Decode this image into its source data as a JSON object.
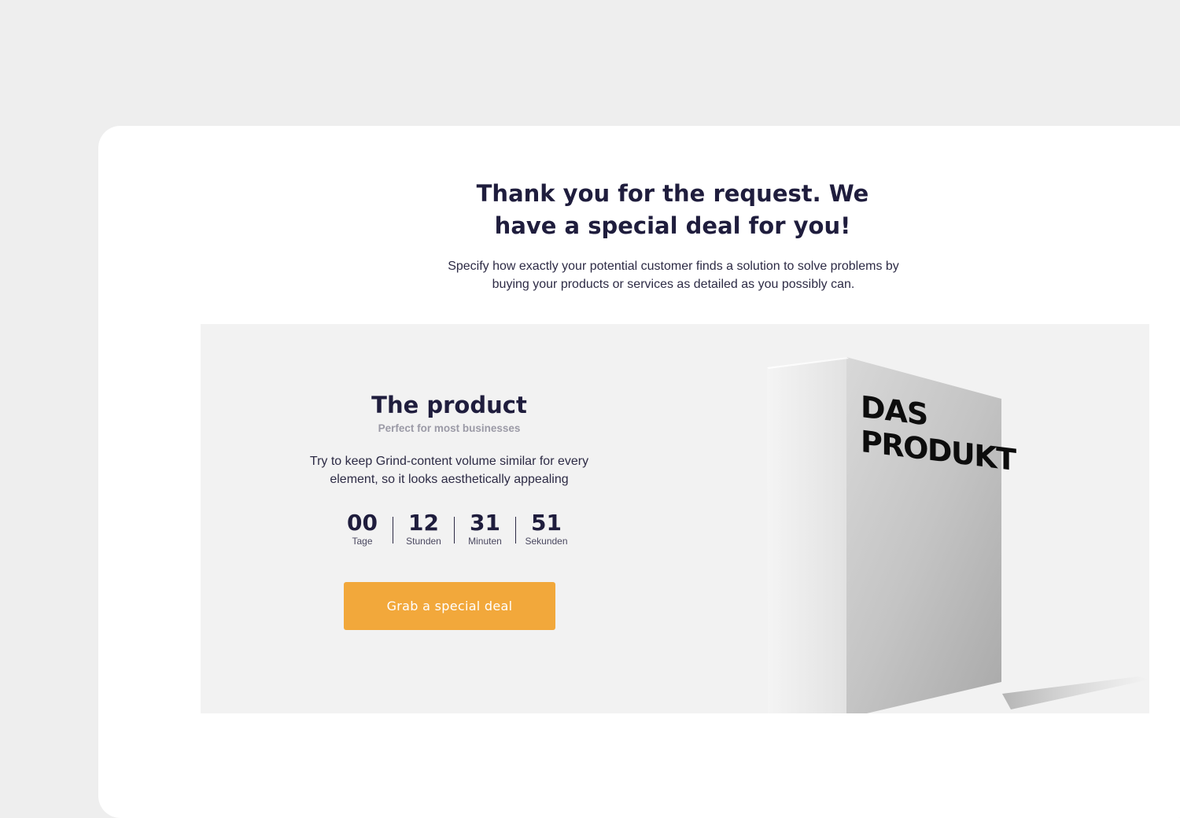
{
  "hero": {
    "title": "Thank you for the request. We have a special deal for you!",
    "description": "Specify how exactly your potential customer finds a solution to solve problems by buying your products or services as detailed as you possibly can."
  },
  "offer": {
    "product_title": "The product",
    "product_subtitle": "Perfect for most businesses",
    "product_description": "Try to keep Grind-content volume similar for every element, so it looks aesthetically appealing",
    "box_text_line1": "DAS",
    "box_text_line2": "PRODUKT",
    "countdown": [
      {
        "value": "00",
        "label": "Tage"
      },
      {
        "value": "12",
        "label": "Stunden"
      },
      {
        "value": "31",
        "label": "Minuten"
      },
      {
        "value": "51",
        "label": "Sekunden"
      }
    ],
    "cta_label": "Grab a special deal"
  },
  "colors": {
    "page_background": "#eeeeee",
    "card_background": "#ffffff",
    "panel_background": "#f2f2f2",
    "heading_text": "#1f1d3d",
    "muted_text": "#9b9aa6",
    "cta_background": "#f2a83b",
    "cta_text": "#ffffff"
  }
}
